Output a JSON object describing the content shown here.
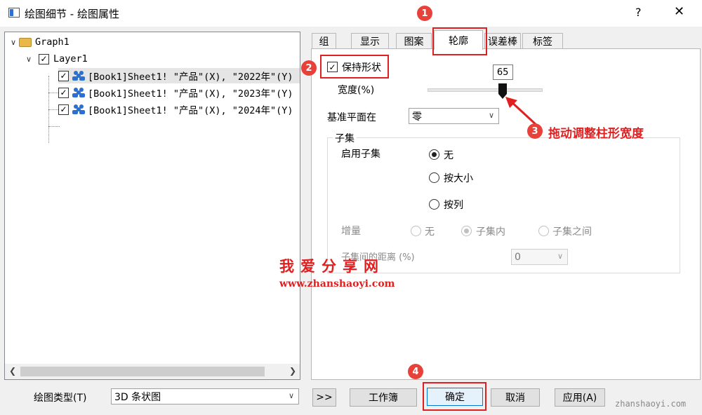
{
  "window": {
    "title": "绘图细节 - 绘图属性",
    "help": "?",
    "close": "✕"
  },
  "tree": {
    "root": "Graph1",
    "layer": "Layer1",
    "items": [
      "[Book1]Sheet1! \"产品\"(X), \"2022年\"(Y)",
      "[Book1]Sheet1! \"产品\"(X), \"2023年\"(Y)",
      "[Book1]Sheet1! \"产品\"(X), \"2024年\"(Y)"
    ]
  },
  "tabs": [
    "组",
    "显示",
    "图案",
    "轮廓",
    "误差棒",
    "标签"
  ],
  "active_tab": "轮廓",
  "outline": {
    "keep_shape_label": "保持形状",
    "keep_shape_checked": true,
    "width_label": "宽度(%)",
    "width_value": "65",
    "width_fraction": 0.65,
    "baseline_label": "基准平面在",
    "baseline_value": "零"
  },
  "subset": {
    "group_title": "子集",
    "enable_label": "启用子集",
    "enable_options": [
      "无",
      "按大小",
      "按列"
    ],
    "enable_selected": 0,
    "increment_label": "增量",
    "increment_options": [
      "无",
      "子集内",
      "子集之间"
    ],
    "increment_selected": 1,
    "distance_label": "子集间的距离 (%)",
    "distance_value": "0"
  },
  "annotations": {
    "n1": "1",
    "n2": "2",
    "n3": "3",
    "n4": "4",
    "drag_hint": "拖动调整柱形宽度"
  },
  "watermark": {
    "cn": "我爱分享网",
    "url": "www.zhanshaoyi.com",
    "corner": "zhanshaoyi.com"
  },
  "bottom": {
    "plot_type_label": "绘图类型(T)",
    "plot_type_value": "3D 条状图",
    "expand": ">>",
    "workbook": "工作簿",
    "ok": "确定",
    "cancel": "取消",
    "apply": "应用(A)"
  },
  "colors": {
    "annotation_red": "#e02020",
    "people_icon_blue": "#2b6fd0",
    "folder_yellow": "#e9b849"
  }
}
